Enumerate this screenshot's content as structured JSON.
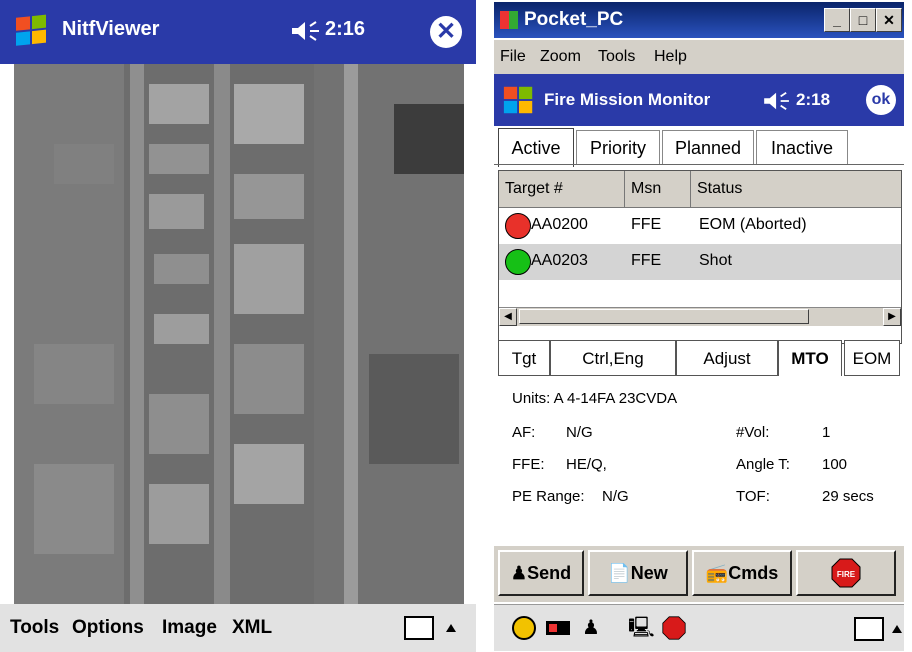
{
  "left_app": {
    "title": "NitfViewer",
    "time": "2:16",
    "close_icon": "x-circle-icon",
    "menu": [
      "Tools",
      "Options",
      "Image",
      "XML"
    ]
  },
  "right_app": {
    "window_title": "Pocket_PC",
    "window_menu": [
      "File",
      "Zoom",
      "Tools",
      "Help"
    ],
    "app_title": "Fire Mission Monitor",
    "time": "2:18",
    "ok_label": "ok",
    "tabs": [
      "Active",
      "Priority",
      "Planned",
      "Inactive"
    ],
    "list": {
      "headers": [
        "Target #",
        "Msn",
        "Status"
      ],
      "rows": [
        {
          "target": "AA0200",
          "msn": "FFE",
          "status": "EOM (Aborted)",
          "color": "#e8312a"
        },
        {
          "target": "AA0203",
          "msn": "FFE",
          "status": "Shot",
          "color": "#16c016"
        }
      ]
    },
    "detail_tabs": [
      "Tgt",
      "Ctrl,Eng",
      "Adjust",
      "MTO",
      "EOM"
    ],
    "details": {
      "units": "Units: A 4-14FA 23CVDA",
      "af_label": "AF:",
      "af_value": "N/G",
      "ffe_label": "FFE:",
      "ffe_value": "HE/Q,",
      "pe_label": "PE Range:",
      "pe_value": "N/G",
      "vol_label": "#Vol:",
      "vol_value": "1",
      "angle_label": "Angle T:",
      "angle_value": "100",
      "tof_label": "TOF:",
      "tof_value": "29 secs"
    },
    "commands": [
      "Send",
      "New",
      "Cmds"
    ],
    "fire_icon_label": "FIRE",
    "taskbar_icons": [
      "clock-icon",
      "battery-icon",
      "soldier-icon",
      "computer-icon",
      "fire-stop-icon"
    ]
  }
}
